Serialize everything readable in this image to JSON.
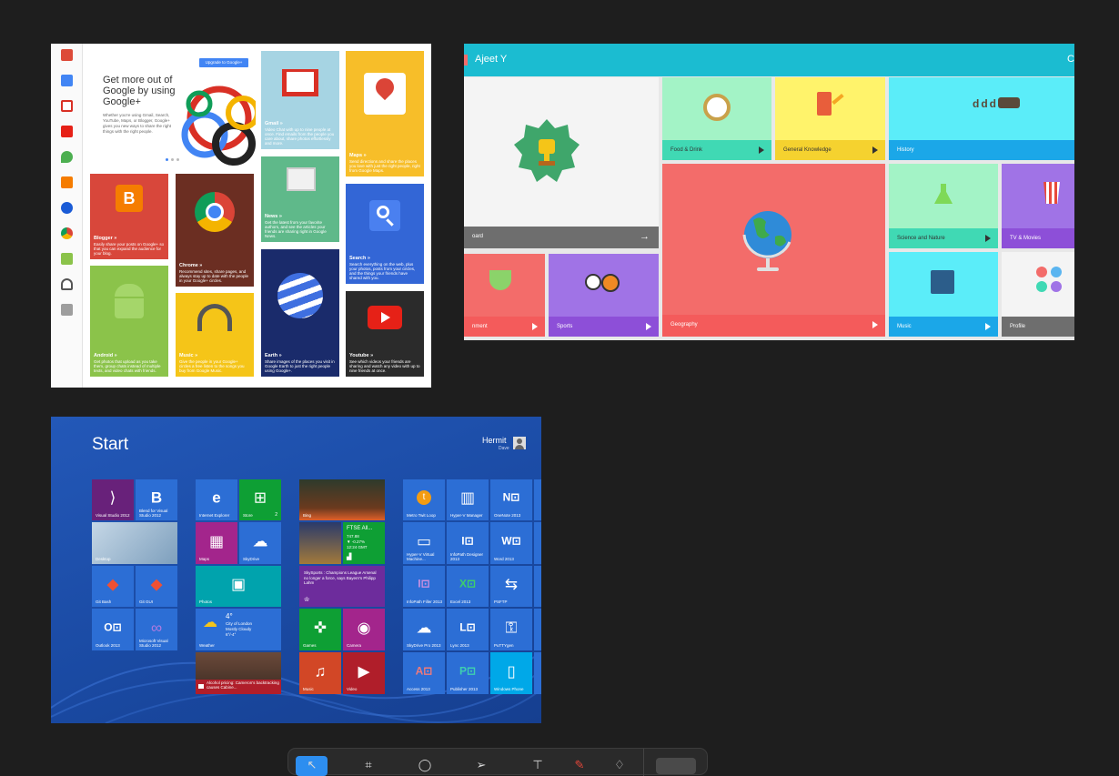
{
  "google_plus": {
    "hero_title": "Get more out of Google by using Google+",
    "hero_text": "Whether you're using Gmail, Search, YouTube, Maps, or Blogger, Google+ gives you new ways to share the right things with the right people.",
    "upgrade_button": "Upgrade to Google+",
    "sidebar_icons": [
      "google-plus-icon",
      "search-icon",
      "gmail-icon",
      "youtube-icon",
      "maps-icon",
      "blogger-icon",
      "earth-icon",
      "chrome-icon",
      "android-icon",
      "music-icon",
      "news-icon"
    ],
    "tiles": {
      "gmail": {
        "title": "Gmail »",
        "text": "Video Chat with up to nine people at once. Find emails from the people you care about, share photos effortlessly and more."
      },
      "maps": {
        "title": "Maps »",
        "text": "Send directions and share the places you love with just the right people, right from Google Maps."
      },
      "news": {
        "title": "News »",
        "text": "Get the latest from your favorite authors, and see the articles your friends are sharing right in Google News."
      },
      "search": {
        "title": "Search »",
        "text": "Search everything on the web, plus your photos, posts from your circles, and the things your friends have shared with you."
      },
      "blogger": {
        "title": "Blogger »",
        "text": "Easily share your posts on Google+ so that you can expand the audience for your blog."
      },
      "chrome": {
        "title": "Chrome »",
        "text": "Recommend sites, share pages, and always stay up to date with the people in your Google+ circles."
      },
      "earth": {
        "title": "Earth »",
        "text": "Share images of the places you visit in Google Earth to just the right people using Google+."
      },
      "youtube": {
        "title": "Youtube »",
        "text": "See which videos your friends are sharing and watch any video with up to nine friends at once."
      },
      "android": {
        "title": "Android »",
        "text": "Get photos that upload as you take them, group chats instead of multiple texts, and video chats with friends."
      },
      "music": {
        "title": "Music »",
        "text": "Give the people in your Google+ circles a free listen to the songs you buy from Google Music."
      }
    }
  },
  "quiz": {
    "user_name": "Ajeet Y",
    "header_right": "C",
    "tiles": {
      "leaderboard": "oard",
      "food": "Food & Drink",
      "general": "General Knowledge",
      "history": "History",
      "geography": "Geography",
      "science": "Science and Nature",
      "tv": "TV & Movies",
      "entertainment": "nment",
      "sports": "Sports",
      "music": "Music",
      "profile": "Profile"
    },
    "colors": {
      "header": "#1bbcd1",
      "teal": "#40d9b4",
      "yellow": "#fff36b",
      "cyan": "#5bedf9",
      "coral": "#f36c6a",
      "purple": "#a073e6",
      "mint": "#a3f3c6",
      "grey": "#e0e0e0"
    }
  },
  "windows": {
    "start_title": "Start",
    "user_name": "Hermit",
    "user_sub": "Dave",
    "tiles": {
      "vs2012": "Visual Studio 2012",
      "blend": "Blend for Visual Studio 2012",
      "ie": "Internet Explorer",
      "store": "Store",
      "store_badge": "2",
      "bing": "Bing",
      "metro_loop": "Metro Twit Loop",
      "hyperv_manager": "Hyper-V Manager",
      "onenote": "OneNote 2013",
      "desktop": "Desktop",
      "maps": "Maps",
      "skydrive": "SkyDrive",
      "finance_title": "FTSE All...",
      "finance_value": "747.88",
      "finance_change": "▼ -0.27%",
      "finance_time": "12:24 GMT",
      "hyperv_vm": "Hyper-V Virtual Machine...",
      "infopath_designer": "InfoPath Designer 2013",
      "word": "Word 2013",
      "git_bash": "Git Bash",
      "git_gui": "Git GUI",
      "photos": "Photos",
      "sports_text": "SkySports : Champions League Arsenal no longer a force, says Bayern's Philipp Lahm",
      "infopath_filler": "InfoPath Filler 2013",
      "excel": "Excel 2013",
      "psftp": "PSFTP",
      "outlook": "Outlook 2013",
      "vs2012_ms": "Microsoft Visual Studio 2012",
      "weather_temp": "4°",
      "weather_city": "City of London",
      "weather_desc": "Mostly Cloudy",
      "weather_range": "6°/-4°",
      "weather": "Weather",
      "games": "Games",
      "camera": "Camera",
      "skydrive_pro": "SkyDrive Pro 2013",
      "lync": "Lync 2013",
      "puttygen": "PuTTYgen",
      "news_text": "Alcohol pricing: Cameron's backtracking causes Cabine...",
      "music": "Music",
      "video": "Video",
      "access": "Access 2013",
      "publisher": "Publisher 2013",
      "windows_phone": "Windows Phone"
    }
  },
  "toolbar": {
    "icons": [
      "select-arrow-icon",
      "crop-icon",
      "comment-icon",
      "pen-icon",
      "text-icon",
      "highlighter-icon",
      "shapes-icon",
      "toggle-switch-icon"
    ]
  }
}
